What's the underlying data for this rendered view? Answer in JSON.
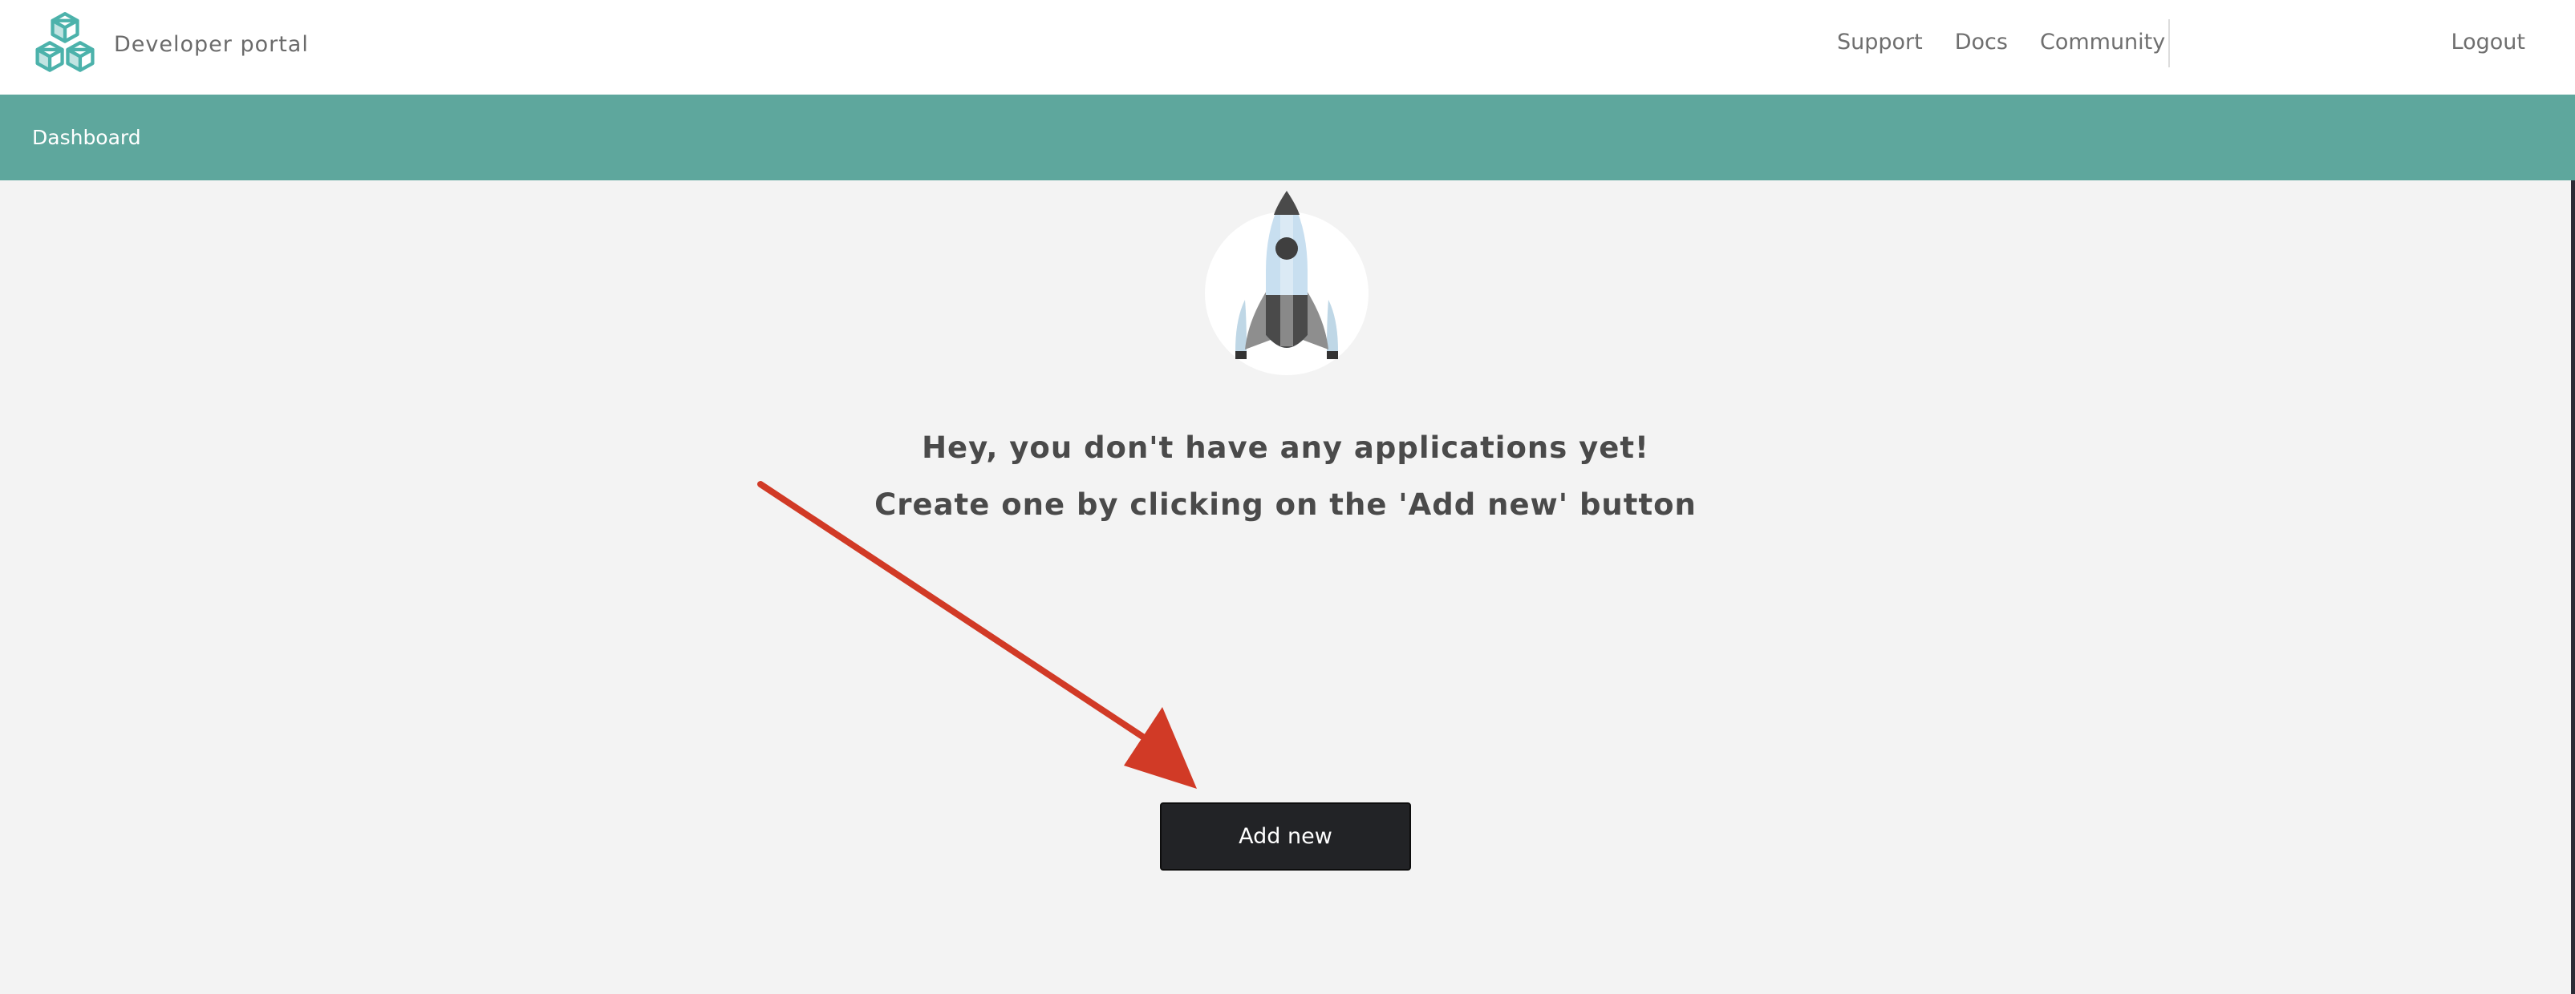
{
  "header": {
    "brand_text": "Developer portal",
    "nav": [
      "Support",
      "Docs",
      "Community"
    ],
    "logout_label": "Logout"
  },
  "subnav": {
    "breadcrumb": "Dashboard"
  },
  "empty_state": {
    "icon": "rocket-icon",
    "line1": "Hey, you don't have any applications yet!",
    "line2": "Create one by clicking on the 'Add new' button",
    "button_label": "Add new"
  },
  "annotation": {
    "icon": "arrow-icon",
    "color": "#d13a26"
  },
  "colors": {
    "accent": "#5ea79d",
    "logo": "#4cb2ab",
    "button": "#222326",
    "page_background": "#f3f3f3"
  }
}
